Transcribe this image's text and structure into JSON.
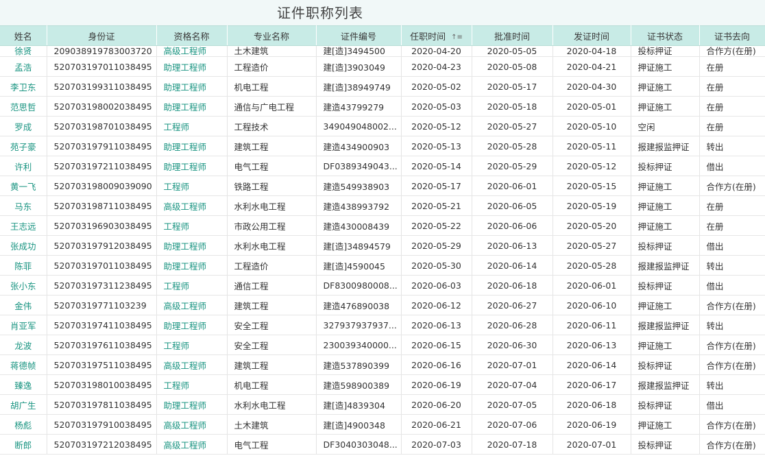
{
  "page": {
    "title": "证件职称列表"
  },
  "table": {
    "columns": [
      "姓名",
      "身份证",
      "资格名称",
      "专业名称",
      "证件编号",
      "任职时间",
      "批准时间",
      "发证时间",
      "证书状态",
      "证书去向"
    ],
    "sort_icon": "sort-ascending-icon",
    "accent_color": "#199481",
    "header_color": "#c8ebe6",
    "rows": [
      [
        "徐贤",
        "209038919783003720",
        "高级工程师",
        "土木建筑",
        "建[造]3494500",
        "2020-04-20",
        "2020-05-05",
        "2020-04-18",
        "投标押证",
        "合作方(在册)"
      ],
      [
        "孟浩",
        "520703197011038495",
        "助理工程师",
        "工程造价",
        "建[造]3903049",
        "2020-04-23",
        "2020-05-08",
        "2020-04-21",
        "押证施工",
        "在册"
      ],
      [
        "李卫东",
        "520703199311038495",
        "助理工程师",
        "机电工程",
        "建[造]38949749",
        "2020-05-02",
        "2020-05-17",
        "2020-04-30",
        "押证施工",
        "在册"
      ],
      [
        "范思哲",
        "520703198002038495",
        "助理工程师",
        "通信与广电工程",
        "建造43799279",
        "2020-05-03",
        "2020-05-18",
        "2020-05-01",
        "押证施工",
        "在册"
      ],
      [
        "罗成",
        "520703198701038495",
        "工程师",
        "工程技术",
        "349049048002...",
        "2020-05-12",
        "2020-05-27",
        "2020-05-10",
        "空闲",
        "在册"
      ],
      [
        "苑子豪",
        "520703197911038495",
        "助理工程师",
        "建筑工程",
        "建造434900903",
        "2020-05-13",
        "2020-05-28",
        "2020-05-11",
        "报建报监押证",
        "转出"
      ],
      [
        "许利",
        "520703197211038495",
        "助理工程师",
        "电气工程",
        "DF0389349043...",
        "2020-05-14",
        "2020-05-29",
        "2020-05-12",
        "投标押证",
        "借出"
      ],
      [
        "黄一飞",
        "520703198009039090",
        "工程师",
        "铁路工程",
        "建造549938903",
        "2020-05-17",
        "2020-06-01",
        "2020-05-15",
        "押证施工",
        "合作方(在册)"
      ],
      [
        "马东",
        "520703198711038495",
        "高级工程师",
        "水利水电工程",
        "建造438993792",
        "2020-05-21",
        "2020-06-05",
        "2020-05-19",
        "押证施工",
        "在册"
      ],
      [
        "王志远",
        "520703196903038495",
        "工程师",
        "市政公用工程",
        "建造430008439",
        "2020-05-22",
        "2020-06-06",
        "2020-05-20",
        "押证施工",
        "在册"
      ],
      [
        "张成功",
        "520703197912038495",
        "助理工程师",
        "水利水电工程",
        "建[造]34894579",
        "2020-05-29",
        "2020-06-13",
        "2020-05-27",
        "投标押证",
        "借出"
      ],
      [
        "陈菲",
        "520703197011038495",
        "助理工程师",
        "工程造价",
        "建[造]4590045",
        "2020-05-30",
        "2020-06-14",
        "2020-05-28",
        "报建报监押证",
        "转出"
      ],
      [
        "张小东",
        "520703197311238495",
        "工程师",
        "通信工程",
        "DF8300980008...",
        "2020-06-03",
        "2020-06-18",
        "2020-06-01",
        "投标押证",
        "借出"
      ],
      [
        "金伟",
        "52070319771103239",
        "高级工程师",
        "建筑工程",
        "建造476890038",
        "2020-06-12",
        "2020-06-27",
        "2020-06-10",
        "押证施工",
        "合作方(在册)"
      ],
      [
        "肖亚军",
        "520703197411038495",
        "助理工程师",
        "安全工程",
        "327937937937...",
        "2020-06-13",
        "2020-06-28",
        "2020-06-11",
        "报建报监押证",
        "转出"
      ],
      [
        "龙波",
        "520703197611038495",
        "工程师",
        "安全工程",
        "230039340000...",
        "2020-06-15",
        "2020-06-30",
        "2020-06-13",
        "押证施工",
        "合作方(在册)"
      ],
      [
        "蒋德帧",
        "520703197511038495",
        "高级工程师",
        "建筑工程",
        "建造537890399",
        "2020-06-16",
        "2020-07-01",
        "2020-06-14",
        "投标押证",
        "合作方(在册)"
      ],
      [
        "臻逸",
        "520703198010038495",
        "工程师",
        "机电工程",
        "建造598900389",
        "2020-06-19",
        "2020-07-04",
        "2020-06-17",
        "报建报监押证",
        "转出"
      ],
      [
        "胡广生",
        "520703197811038495",
        "助理工程师",
        "水利水电工程",
        "建[造]4839304",
        "2020-06-20",
        "2020-07-05",
        "2020-06-18",
        "投标押证",
        "借出"
      ],
      [
        "杨彪",
        "520703197910038495",
        "高级工程师",
        "土木建筑",
        "建[造]4900348",
        "2020-06-21",
        "2020-07-06",
        "2020-06-19",
        "押证施工",
        "合作方(在册)"
      ],
      [
        "断郎",
        "520703197212038495",
        "高级工程师",
        "电气工程",
        "DF3040303048...",
        "2020-07-03",
        "2020-07-18",
        "2020-07-01",
        "投标押证",
        "合作方(在册)"
      ]
    ]
  }
}
